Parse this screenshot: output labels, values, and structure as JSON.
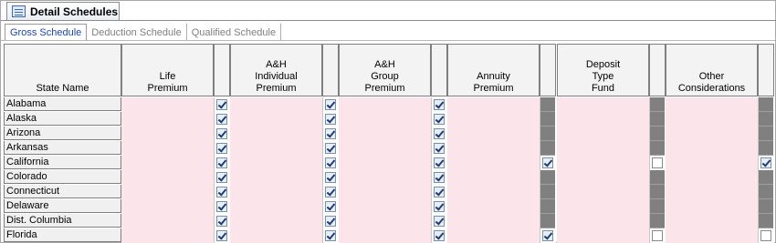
{
  "window_tab": {
    "title": "Detail Schedules",
    "icon": "schedule-icon"
  },
  "sub_tabs": [
    {
      "label": "Gross Schedule",
      "active": true
    },
    {
      "label": "Deduction Schedule",
      "active": false
    },
    {
      "label": "Qualified Schedule",
      "active": false
    }
  ],
  "grid": {
    "state_header": "State Name",
    "columns": [
      {
        "label": "Life Premium",
        "lines": [
          "Life",
          "Premium"
        ]
      },
      {
        "label": "A&H Individual Premium",
        "lines": [
          "A&H",
          "Individual",
          "Premium"
        ]
      },
      {
        "label": "A&H Group Premium",
        "lines": [
          "A&H",
          "Group",
          "Premium"
        ]
      },
      {
        "label": "Annuity Premium",
        "lines": [
          "Annuity",
          "Premium"
        ]
      },
      {
        "label": "Deposit Type Fund",
        "lines": [
          "Deposit",
          "Type",
          "Fund"
        ]
      },
      {
        "label": "Other Considerations",
        "lines": [
          "Other",
          "Considerations"
        ]
      }
    ],
    "rows": [
      {
        "state": "Alabama",
        "checks": [
          "on",
          "on",
          "on",
          "gray",
          "gray",
          "gray"
        ]
      },
      {
        "state": "Alaska",
        "checks": [
          "on",
          "on",
          "on",
          "gray",
          "gray",
          "gray"
        ]
      },
      {
        "state": "Arizona",
        "checks": [
          "on",
          "on",
          "on",
          "gray",
          "gray",
          "gray"
        ]
      },
      {
        "state": "Arkansas",
        "checks": [
          "on",
          "on",
          "on",
          "gray",
          "gray",
          "gray"
        ]
      },
      {
        "state": "California",
        "checks": [
          "on",
          "on",
          "on",
          "on",
          "off",
          "on"
        ]
      },
      {
        "state": "Colorado",
        "checks": [
          "on",
          "on",
          "on",
          "gray",
          "gray",
          "gray"
        ]
      },
      {
        "state": "Connecticut",
        "checks": [
          "on",
          "on",
          "on",
          "gray",
          "gray",
          "gray"
        ]
      },
      {
        "state": "Delaware",
        "checks": [
          "on",
          "on",
          "on",
          "gray",
          "gray",
          "gray"
        ]
      },
      {
        "state": "Dist. Columbia",
        "checks": [
          "on",
          "on",
          "on",
          "gray",
          "gray",
          "gray"
        ]
      },
      {
        "state": "Florida",
        "checks": [
          "on",
          "on",
          "on",
          "on",
          "off",
          "off"
        ]
      }
    ]
  }
}
